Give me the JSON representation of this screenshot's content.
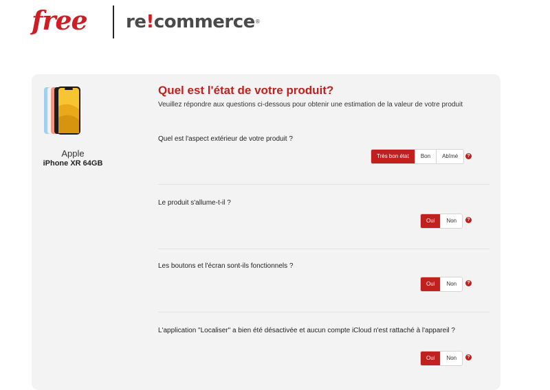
{
  "header": {
    "logo_free": "free",
    "logo_recommerce_prefix": "re",
    "logo_recommerce_excl": "!",
    "logo_recommerce_suffix": "commerce",
    "logo_recommerce_reg": "®"
  },
  "product": {
    "brand": "Apple",
    "model": "iPhone XR 64GB",
    "image_icon": "phone-image"
  },
  "form": {
    "title": "Quel est l'état de votre produit?",
    "intro": "Veuillez répondre aux questions ci-dessous pour obtenir une estimation de la valeur de votre produit",
    "questions": [
      {
        "text": "Quel est l'aspect extérieur de votre produit ?",
        "options": [
          "Très bon état",
          "Bon",
          "Abîmé"
        ],
        "selected": "Très bon état",
        "help": "?"
      },
      {
        "text": "Le produit s'allume-t-il ?",
        "options": [
          "Oui",
          "Non"
        ],
        "selected": "Oui",
        "help": "?"
      },
      {
        "text": "Les boutons et l'écran sont-ils fonctionnels ?",
        "options": [
          "Oui",
          "Non"
        ],
        "selected": "Oui",
        "help": "?"
      },
      {
        "text": "L'application \"Localiser\" a bien été désactivée et aucun compte iCloud n'est rattaché à l'appareil ?",
        "options": [
          "Oui",
          "Non"
        ],
        "selected": "Oui",
        "help": "?"
      }
    ]
  },
  "colors": {
    "accent": "#c0211f",
    "free_red": "#cd1e25",
    "card_bg": "#f3f3f3"
  }
}
